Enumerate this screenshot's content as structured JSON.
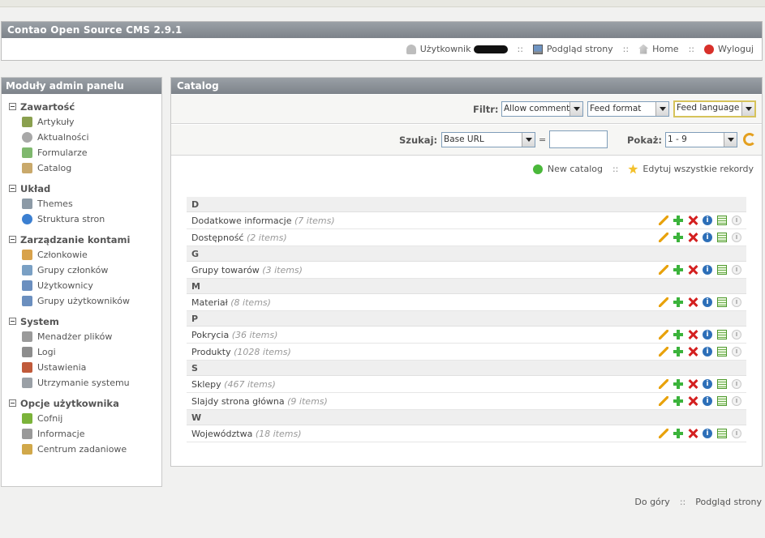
{
  "app": {
    "title": "Contao Open Source CMS 2.9.1"
  },
  "header_nav": {
    "user_label": "Użytkownik",
    "preview_label": "Podgląd strony",
    "home_label": "Home",
    "logout_label": "Wyloguj",
    "separator": "::"
  },
  "sidebar": {
    "title": "Moduły admin panelu",
    "groups": [
      {
        "label": "Zawartość",
        "items": [
          {
            "label": "Artykuły",
            "icon": "article-icon",
            "color": "#8aa04f"
          },
          {
            "label": "Aktualności",
            "icon": "news-clock-icon",
            "color": "#a8a8a8"
          },
          {
            "label": "Formularze",
            "icon": "form-icon",
            "color": "#7fb86e"
          },
          {
            "label": "Catalog",
            "icon": "catalog-icon",
            "color": "#c9a96b"
          }
        ]
      },
      {
        "label": "Układ",
        "items": [
          {
            "label": "Themes",
            "icon": "themes-icon",
            "color": "#8c9aa6"
          },
          {
            "label": "Struktura stron",
            "icon": "globe-icon",
            "color": "#3b7fd1"
          }
        ]
      },
      {
        "label": "Zarządzanie kontami",
        "items": [
          {
            "label": "Członkowie",
            "icon": "member-icon",
            "color": "#d8a24b"
          },
          {
            "label": "Grupy członków",
            "icon": "member-group-icon",
            "color": "#7aa0c4"
          },
          {
            "label": "Użytkownicy",
            "icon": "user-icon",
            "color": "#6b8fbf"
          },
          {
            "label": "Grupy użytkowników",
            "icon": "user-group-icon",
            "color": "#6b8fbf"
          }
        ]
      },
      {
        "label": "System",
        "items": [
          {
            "label": "Menadżer plików",
            "icon": "file-manager-icon",
            "color": "#9a9a9a"
          },
          {
            "label": "Logi",
            "icon": "logs-icon",
            "color": "#8d8d8d"
          },
          {
            "label": "Ustawienia",
            "icon": "settings-icon",
            "color": "#c05a3a"
          },
          {
            "label": "Utrzymanie systemu",
            "icon": "maintenance-icon",
            "color": "#9aa0a6"
          }
        ]
      },
      {
        "label": "Opcje użytkownika",
        "items": [
          {
            "label": "Cofnij",
            "icon": "undo-icon",
            "color": "#7bb33a"
          },
          {
            "label": "Informacje",
            "icon": "info-icon",
            "color": "#999999"
          },
          {
            "label": "Centrum zadaniowe",
            "icon": "task-center-icon",
            "color": "#d1a84a"
          }
        ]
      }
    ]
  },
  "main": {
    "title": "Catalog",
    "filter_label": "Filtr:",
    "filters": [
      "Allow comments",
      "Feed format",
      "Feed language"
    ],
    "search_label": "Szukaj:",
    "search_field": "Base URL",
    "equals": "=",
    "search_value": "",
    "show_label": "Pokaż:",
    "show_value": "1 - 9",
    "actions": {
      "new_catalog": "New catalog",
      "separator": "::",
      "edit_all": "Edytuj wszystkie rekordy"
    },
    "sections": [
      {
        "letter": "D",
        "items": [
          {
            "name": "Dodatkowe informacje",
            "count": "(7 items)"
          },
          {
            "name": "Dostępność",
            "count": "(2 items)"
          }
        ]
      },
      {
        "letter": "G",
        "items": [
          {
            "name": "Grupy towarów",
            "count": "(3 items)"
          }
        ]
      },
      {
        "letter": "M",
        "items": [
          {
            "name": "Materiał",
            "count": "(8 items)"
          }
        ]
      },
      {
        "letter": "P",
        "items": [
          {
            "name": "Pokrycia",
            "count": "(36 items)"
          },
          {
            "name": "Produkty",
            "count": "(1028 items)"
          }
        ]
      },
      {
        "letter": "S",
        "items": [
          {
            "name": "Sklepy",
            "count": "(467 items)"
          },
          {
            "name": "Slajdy strona główna",
            "count": "(9 items)"
          }
        ]
      },
      {
        "letter": "W",
        "items": [
          {
            "name": "Województwa",
            "count": "(18 items)"
          }
        ]
      }
    ]
  },
  "footer": {
    "top_label": "Do góry",
    "separator": "::",
    "preview_label": "Podgląd strony"
  }
}
